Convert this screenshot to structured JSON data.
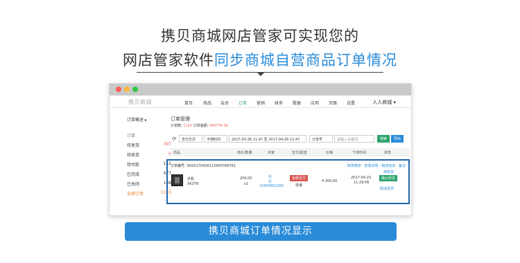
{
  "headline": {
    "line1": "携贝商城网店管家可实现您的",
    "line2_plain": "网店管家软件",
    "line2_highlight": "同步商城自营商品订单情况"
  },
  "browser": {
    "logo": "携贝商城",
    "nav": [
      "首页",
      "商品",
      "会员",
      "订单",
      "营销",
      "财务",
      "数据",
      "应用",
      "页面",
      "设置"
    ],
    "active_nav": "订单",
    "store_name": "人人商城 ▾"
  },
  "sidebar": {
    "overview": "订单概述 ▸",
    "group": "订单",
    "items": [
      {
        "label": "待发货",
        "count": "397"
      },
      {
        "label": "待收货",
        "count": "6"
      },
      {
        "label": "待付款",
        "count": "151"
      },
      {
        "label": "已完成",
        "count": "427"
      },
      {
        "label": "已关闭",
        "count": "168"
      },
      {
        "label": "全部订单",
        "count": "1110"
      }
    ]
  },
  "main": {
    "title": "订单管理",
    "summary_prefix": "订单数: ",
    "summary_count": "1110",
    "summary_mid": " 订单金额: ",
    "summary_amount": "560776.39",
    "filters": {
      "refresh": "⟳",
      "pay_method": "支付方式",
      "time_filter": "不搜时间",
      "date_range": "2017-03-26 11:47 至 2017-04-26 11:47",
      "order_no": "订单号",
      "keyword_placeholder": "请输入关键词",
      "search_btn": "搜索",
      "export_btn": "导出"
    },
    "columns": [
      "商品",
      "单价/数量",
      "买家",
      "支付/配送",
      "价格",
      "下单时间",
      "状态"
    ],
    "order": {
      "order_no": "订单编号: SH20170426112956768762",
      "actions": "修改物流 · 查看详情 · 物流信息 · 备注",
      "product_name": "手机",
      "product_code": "XK378",
      "unit_price": "200.00",
      "qty": "x1",
      "buyer_name": "乐",
      "buyer_sub": "乐",
      "buyer_phone": "15659662263",
      "pay_tag": "余额支付",
      "shipping": "快递",
      "price": "¥:200.00",
      "time": "2017-04-23",
      "time2": "11:29:56",
      "status": "待收货",
      "confirm_btn": "确认收货",
      "cancel_link": "取消发货"
    }
  },
  "cta": "携贝商城订单情况显示",
  "colors": {
    "accent": "#2a8bd8",
    "green": "#2aa36b",
    "red": "#d9534f",
    "frame": "#1d63a8"
  }
}
